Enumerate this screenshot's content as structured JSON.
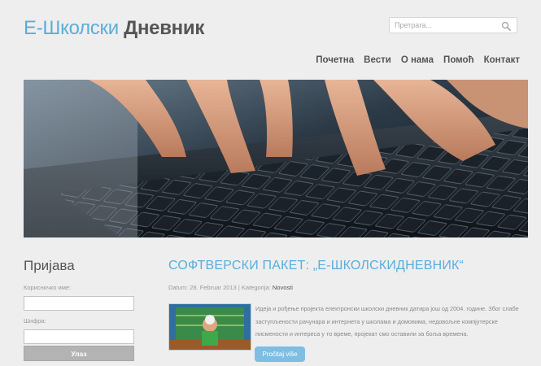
{
  "header": {
    "logo_part1": "Е-Школски",
    "logo_part2": "Дневник",
    "search_placeholder": "Претрага..."
  },
  "nav": {
    "items": [
      "Почетна",
      "Вести",
      "О нама",
      "Помоћ",
      "Контакт"
    ]
  },
  "login": {
    "title": "Пријава",
    "username_label": "Корисничко име:",
    "password_label": "Шифра:",
    "button_label": "Улаз"
  },
  "article": {
    "title": "СОФТВЕРСКИ ПАКЕТ: „Е-ШКОЛСКИДНЕВНИК“",
    "meta_prefix": "Datum: 28. Februar 2013  |  Kategorija: ",
    "category": "Novosti",
    "excerpt": "Идеја и рођење пројекта електронски школски дневник датира још од 2004. године. Због слабе заступљености рачунара и  интернета у школама и домовима, недовољне компјутерске писмености и интереса у то време, пројекат смо оставили за боља времена.",
    "read_more": "Pročitaj više"
  },
  "colors": {
    "accent": "#5aaedb",
    "button_blue": "#7fbde3",
    "button_gray": "#b3b3b3",
    "background": "#eeeeee"
  }
}
